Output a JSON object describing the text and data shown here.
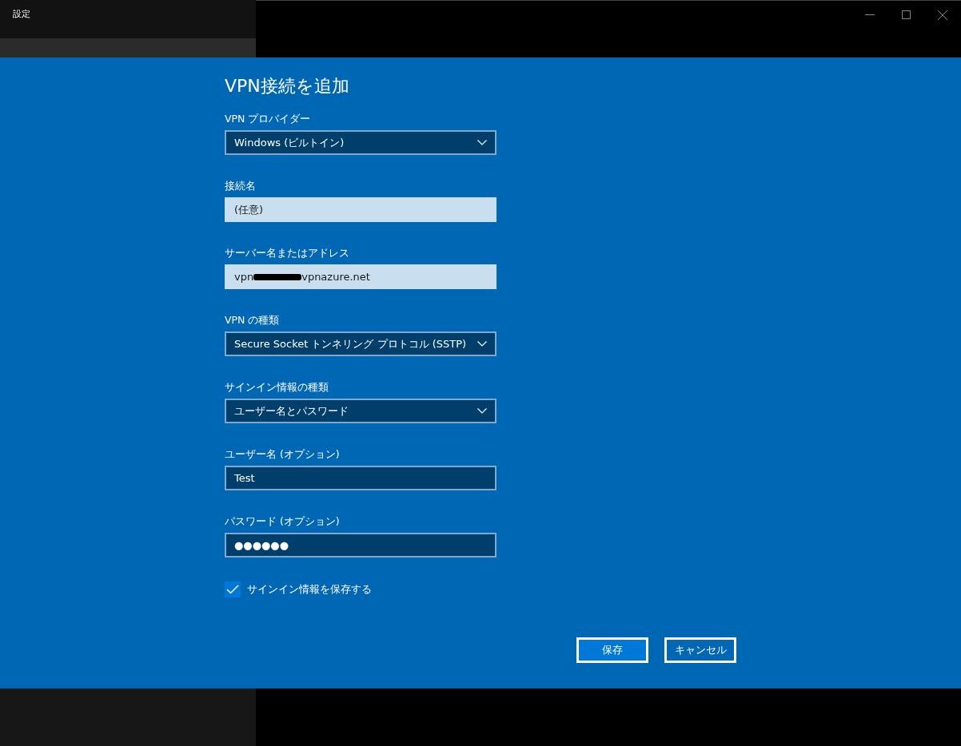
{
  "window": {
    "title": "設定"
  },
  "dialog": {
    "title": "VPN接続を追加",
    "fields": [
      {
        "kind": "select",
        "label": "VPN プロバイダー",
        "value": "Windows (ビルトイン)"
      },
      {
        "kind": "text",
        "label": "接続名",
        "placeholder": "(任意)",
        "dark": false
      },
      {
        "kind": "text",
        "label": "サーバー名またはアドレス",
        "value": "vpn",
        "value_after": "vpnazure.net",
        "redacted": true,
        "dark": false
      },
      {
        "kind": "select",
        "label": "VPN の種類",
        "value": "Secure Socket トンネリング プロトコル (SSTP)"
      },
      {
        "kind": "select",
        "label": "サインイン情報の種類",
        "value": "ユーザー名とパスワード"
      },
      {
        "kind": "text",
        "label": "ユーザー名 (オプション)",
        "value": "Test",
        "dark": true
      },
      {
        "kind": "text",
        "label": "パスワード (オプション)",
        "value": "●●●●●●",
        "dark": true
      }
    ],
    "checkbox": {
      "label": "サインイン情報を保存する",
      "checked": true
    },
    "buttons": [
      {
        "label": "保存",
        "primary": true
      },
      {
        "label": "キャンセル",
        "primary": false
      }
    ]
  }
}
